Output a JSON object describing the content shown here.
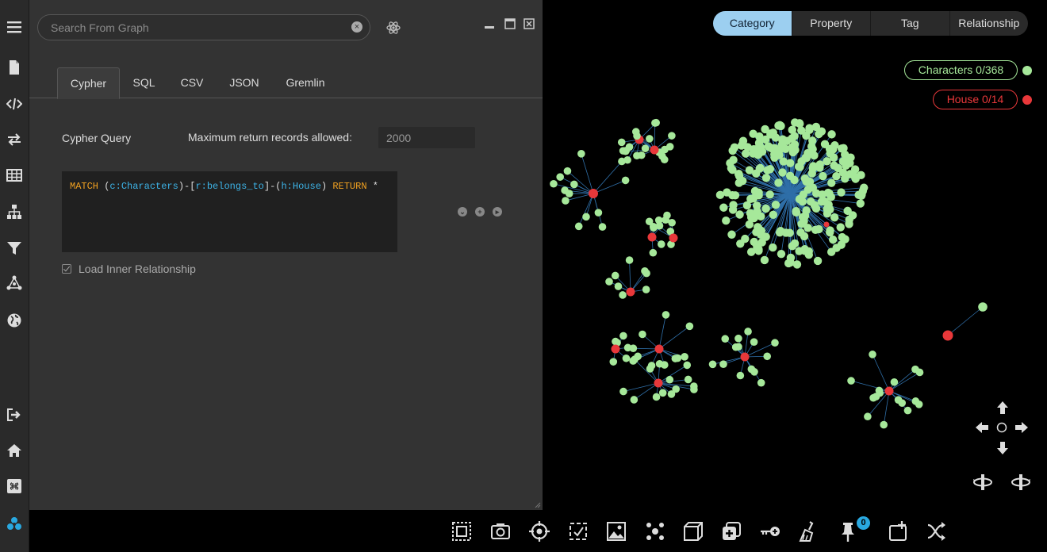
{
  "search": {
    "placeholder": "Search From Graph",
    "value": ""
  },
  "tabs": [
    {
      "label": "Cypher",
      "active": true
    },
    {
      "label": "SQL",
      "active": false
    },
    {
      "label": "CSV",
      "active": false
    },
    {
      "label": "JSON",
      "active": false
    },
    {
      "label": "Gremlin",
      "active": false
    }
  ],
  "query_panel": {
    "cypher_label": "Cypher Query",
    "max_label": "Maximum return records allowed:",
    "max_value": "2000",
    "code": {
      "match": "MATCH",
      "open1": " (",
      "c_label": "c:Characters",
      "mid1": ")-[",
      "r_label": "r:belongs_to",
      "mid2": "]-(",
      "h_label": "h:House",
      "close": ") ",
      "ret": "RETURN",
      "star": " *"
    },
    "load_inner_label": "Load Inner Relationship",
    "load_inner_checked": true
  },
  "category_tabs": [
    {
      "label": "Category",
      "active": true
    },
    {
      "label": "Property",
      "active": false
    },
    {
      "label": "Tag",
      "active": false
    },
    {
      "label": "Relationship",
      "active": false
    }
  ],
  "legend": [
    {
      "label": "Characters 0/368",
      "color": "#a6e89a"
    },
    {
      "label": "House 0/14",
      "color": "#e8383a"
    }
  ],
  "colors": {
    "character": "#a6e89a",
    "house": "#e8383a",
    "edge": "#2f6fa8",
    "accent": "#9ccff0"
  },
  "sidebar_icons": [
    "menu-icon",
    "document-icon",
    "code-icon",
    "swap-icon",
    "table-icon",
    "hierarchy-icon",
    "filter-icon",
    "graph-icon",
    "globe-icon",
    "logout-icon",
    "home-icon",
    "command-icon",
    "app-logo-icon"
  ],
  "toolbar_icons": [
    "select-all-icon",
    "camera-icon",
    "target-icon",
    "check-frame-icon",
    "image-icon",
    "cluster-icon",
    "cube-icon",
    "add-layer-icon",
    "key-icon",
    "broom-icon",
    "pin-icon",
    "new-window-icon",
    "shuffle-icon"
  ],
  "pin_count": "0"
}
